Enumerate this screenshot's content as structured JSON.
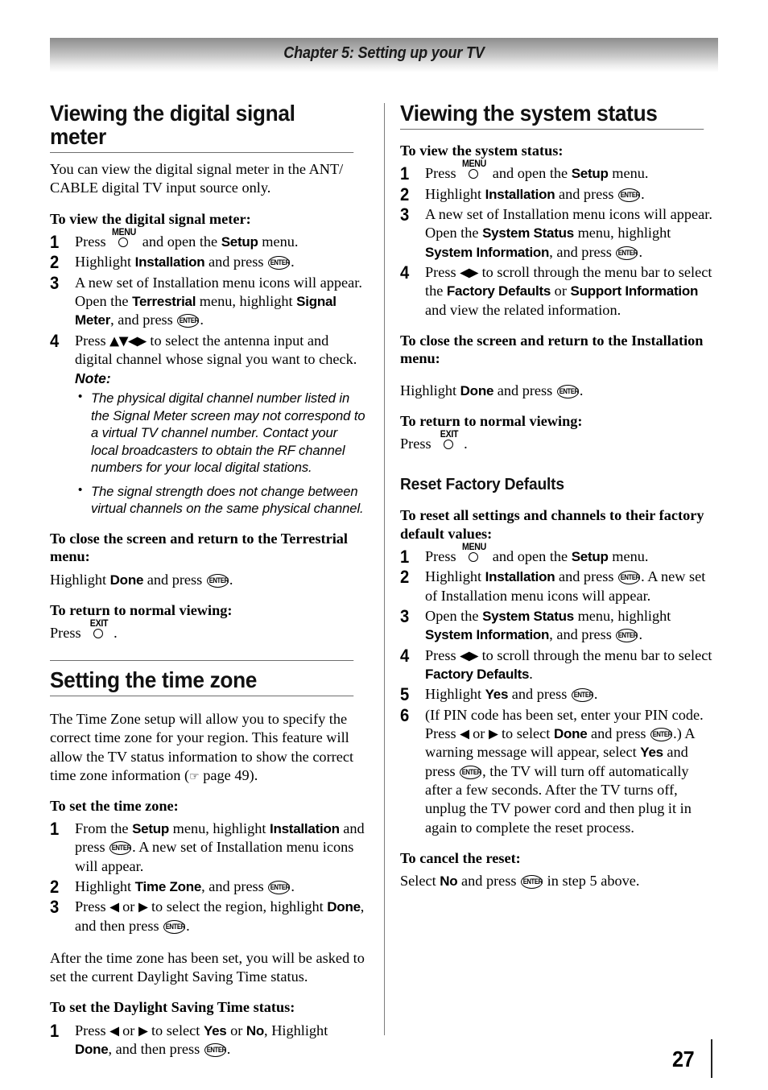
{
  "header": {
    "chapter_title": "Chapter 5: Setting up your TV"
  },
  "icons": {
    "menu_label": "MENU",
    "exit_label": "EXIT",
    "enter_label": "ENTER",
    "arrows_all": "▲▼◀▶",
    "arrows_lr": "◀▶",
    "arrow_left": "◀",
    "arrow_right": "▶",
    "pointing_hand": "☞"
  },
  "left_column": {
    "section1": {
      "heading": "Viewing the digital signal meter",
      "intro": "You can view the digital signal meter in the ANT/ CABLE digital TV input source only.",
      "proc_heading": "To view the digital signal meter:",
      "step1_a": "Press ",
      "step1_b": " and open the ",
      "step1_ui": "Setup",
      "step1_c": " menu.",
      "step2_a": "Highlight ",
      "step2_ui": "Installation",
      "step2_b": " and press ",
      "step2_c": ".",
      "step3_a": "A new set of Installation menu icons will appear. Open the ",
      "step3_ui1": "Terrestrial",
      "step3_b": " menu, highlight ",
      "step3_ui2": "Signal Meter",
      "step3_c": ", and press ",
      "step3_d": ".",
      "step4_a": "Press ",
      "step4_b": " to select the antenna input and digital channel whose signal you want to check.",
      "note_label": "Note:",
      "note_bullets": [
        "The physical digital channel number listed in the Signal Meter screen may not correspond to a virtual TV channel number. Contact your local broadcasters to obtain the RF channel numbers for your local digital stations.",
        "The signal strength does not change between virtual channels on the same physical channel."
      ],
      "close_heading": "To close the screen and return to the Terrestrial menu:",
      "close_a": "Highlight ",
      "close_ui": "Done",
      "close_b": " and press ",
      "close_c": ".",
      "return_heading": "To return to normal viewing:",
      "return_a": "Press ",
      "return_b": "."
    },
    "section2": {
      "heading": "Setting the time zone",
      "intro_a": "The Time Zone setup will allow you to specify the correct time zone for your region. This feature will allow the TV status information to show the correct time zone information (",
      "intro_b": " page 49).",
      "proc_heading": "To set the time zone:",
      "step1_a": "From the ",
      "step1_ui1": "Setup",
      "step1_b": " menu, highlight ",
      "step1_ui2": "Installation",
      "step1_c": " and press ",
      "step1_d": ". A new set of Installation menu icons will appear.",
      "step2_a": "Highlight ",
      "step2_ui": "Time Zone",
      "step2_b": ", and press ",
      "step2_c": ".",
      "step3_a": "Press ",
      "step3_b": " or ",
      "step3_c": " to select the region, highlight ",
      "step3_ui": "Done",
      "step3_d": ", and then press ",
      "step3_e": ".",
      "after_text": "After the time zone has been set, you will be asked to set the current Daylight Saving Time status.",
      "dst_heading": "To set the Daylight Saving Time status:",
      "dst1_a": "Press ",
      "dst1_b": " or ",
      "dst1_c": " to select ",
      "dst1_ui1": "Yes",
      "dst1_d": " or ",
      "dst1_ui2": "No",
      "dst1_e": ", Highlight ",
      "dst1_ui3": "Done",
      "dst1_f": ", and then press ",
      "dst1_g": "."
    }
  },
  "right_column": {
    "section1": {
      "heading": "Viewing the system status",
      "proc_heading": "To view the system status:",
      "step1_a": "Press ",
      "step1_b": " and open the ",
      "step1_ui": "Setup",
      "step1_c": " menu.",
      "step2_a": "Highlight ",
      "step2_ui": "Installation",
      "step2_b": " and press ",
      "step2_c": ".",
      "step3_a": "A new set of Installation menu icons will appear. Open the ",
      "step3_ui1": "System Status",
      "step3_b": " menu, highlight ",
      "step3_ui2": "System Information",
      "step3_c": ", and press ",
      "step3_d": ".",
      "step4_a": "Press ",
      "step4_b": " to scroll through the menu bar to select the ",
      "step4_ui1": "Factory Defaults",
      "step4_c": " or ",
      "step4_ui2": "Support Information",
      "step4_d": " and view the related information.",
      "close_heading": "To close the screen and return to the Installation menu:",
      "close_a": "Highlight ",
      "close_ui": "Done",
      "close_b": " and press ",
      "close_c": ".",
      "return_heading": "To return to normal viewing:",
      "return_a": "Press ",
      "return_b": "."
    },
    "section2": {
      "heading": "Reset Factory Defaults",
      "proc_heading": "To reset all settings and channels to their factory default values:",
      "step1_a": "Press ",
      "step1_b": " and open the ",
      "step1_ui": "Setup",
      "step1_c": " menu.",
      "step2_a": "Highlight ",
      "step2_ui": "Installation",
      "step2_b": " and press ",
      "step2_c": ". A new set of Installation menu icons will appear.",
      "step3_a": "Open the ",
      "step3_ui1": "System Status",
      "step3_b": " menu, highlight ",
      "step3_ui2": "System Information",
      "step3_c": ", and press ",
      "step3_d": ".",
      "step4_a": "Press ",
      "step4_b": " to scroll through the menu bar to select ",
      "step4_ui": "Factory Defaults",
      "step4_c": ".",
      "step5_a": "Highlight ",
      "step5_ui": "Yes",
      "step5_b": " and press ",
      "step5_c": ".",
      "step6_a": "(If PIN code has been set, enter your PIN code. Press ",
      "step6_b": " or ",
      "step6_c": " to select ",
      "step6_ui1": "Done",
      "step6_d": " and press ",
      "step6_e": ".) A warning message will appear, select ",
      "step6_ui2": "Yes",
      "step6_f": " and press ",
      "step6_g": ", the TV will turn off automatically after a few seconds. After the TV turns off, unplug the TV power cord and then plug it in again to complete the reset process.",
      "cancel_heading": "To cancel the reset:",
      "cancel_a": "Select ",
      "cancel_ui": "No",
      "cancel_b": " and press ",
      "cancel_c": " in step 5 above."
    }
  },
  "footer": {
    "page_number": "27"
  }
}
